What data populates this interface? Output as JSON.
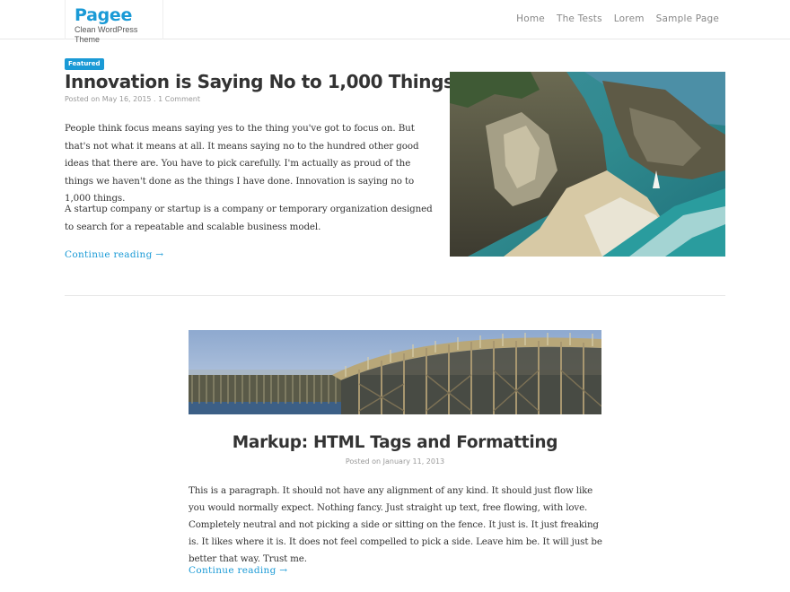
{
  "site": {
    "name": "Pagee",
    "tagline": "Clean WordPress Theme"
  },
  "nav": {
    "items": [
      "Home",
      "The Tests",
      "Lorem",
      "Sample Page"
    ]
  },
  "posts": [
    {
      "badge": "Featured",
      "title": "Innovation is Saying No to 1,000 Things",
      "meta_prefix": "Posted on ",
      "date": "May 16, 2015",
      "separator": " . ",
      "comments": "1 Comment",
      "paragraphs": [
        "People think focus means saying yes to the thing you've got to focus on. But that's not what it means at all. It means saying no to the hundred other good ideas that there are. You have to pick carefully. I'm actually as proud of the things we haven't done as the things I have done. Innovation is saying no to 1,000 things.",
        "A startup company or startup is a company or temporary organization designed to search for a repeatable and scalable business model."
      ],
      "continue_label": "Continue reading →"
    },
    {
      "title": "Markup: HTML Tags and Formatting",
      "meta_prefix": "Posted on ",
      "date": "January 11, 2013",
      "paragraphs": [
        "This is a paragraph. It should not have any alignment of any kind. It should just flow like you would normally expect. Nothing fancy. Just straight up text, free flowing, with love. Completely neutral and not picking a side or sitting on the fence. It just is. It just freaking is. It likes where it is. It does not feel compelled to pick a side. Leave him be. It will just be better that way. Trust me."
      ],
      "continue_label": "Continue reading →"
    }
  ],
  "colors": {
    "accent": "#1a9ad6",
    "text": "#333333",
    "meta": "#999999"
  }
}
